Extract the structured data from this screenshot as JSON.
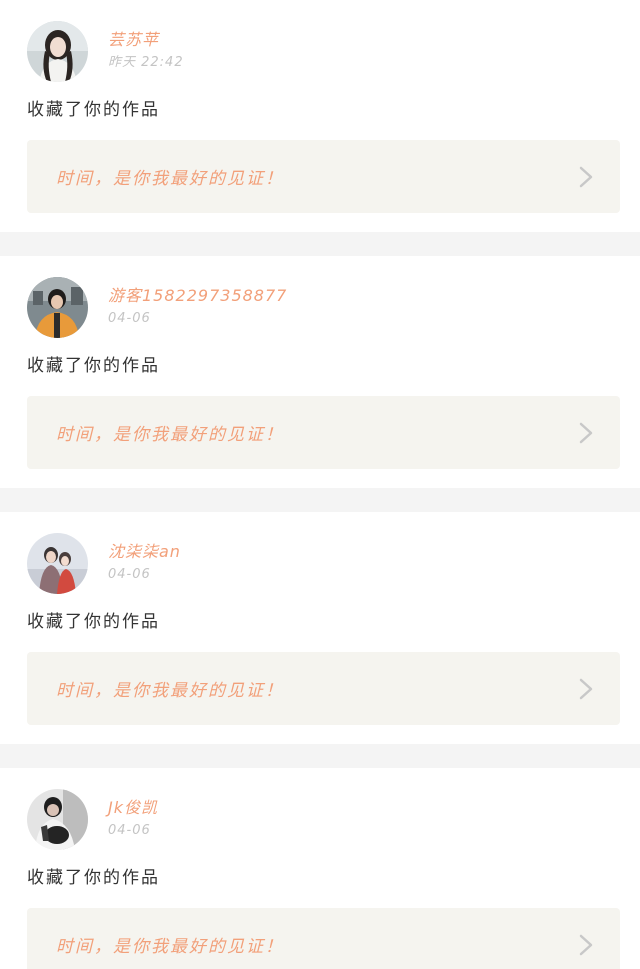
{
  "feed": [
    {
      "username": "芸苏苹",
      "time": "昨天 22:42",
      "action": "收藏了你的作品",
      "work_title": "时间，是你我最好的见证！",
      "avatar_icon": "avatar-portrait-girl"
    },
    {
      "username": "游客15822973588​77",
      "time": "04-06",
      "action": "收藏了你的作品",
      "work_title": "时间，是你我最好的见证！",
      "avatar_icon": "avatar-portrait-boy-orange"
    },
    {
      "username": "沈柒柒an",
      "time": "04-06",
      "action": "收藏了你的作品",
      "work_title": "时间，是你我最好的见证！",
      "avatar_icon": "avatar-couple-photo"
    },
    {
      "username": "Jk俊凯",
      "time": "04-06",
      "action": "收藏了你的作品",
      "work_title": "时间，是你我最好的见证！",
      "avatar_icon": "avatar-portrait-dark"
    }
  ],
  "colors": {
    "accent": "#f2a07a",
    "timestamp": "#c4c4c4",
    "link_bg": "#f5f4ef",
    "chevron": "#c8c8c8"
  }
}
